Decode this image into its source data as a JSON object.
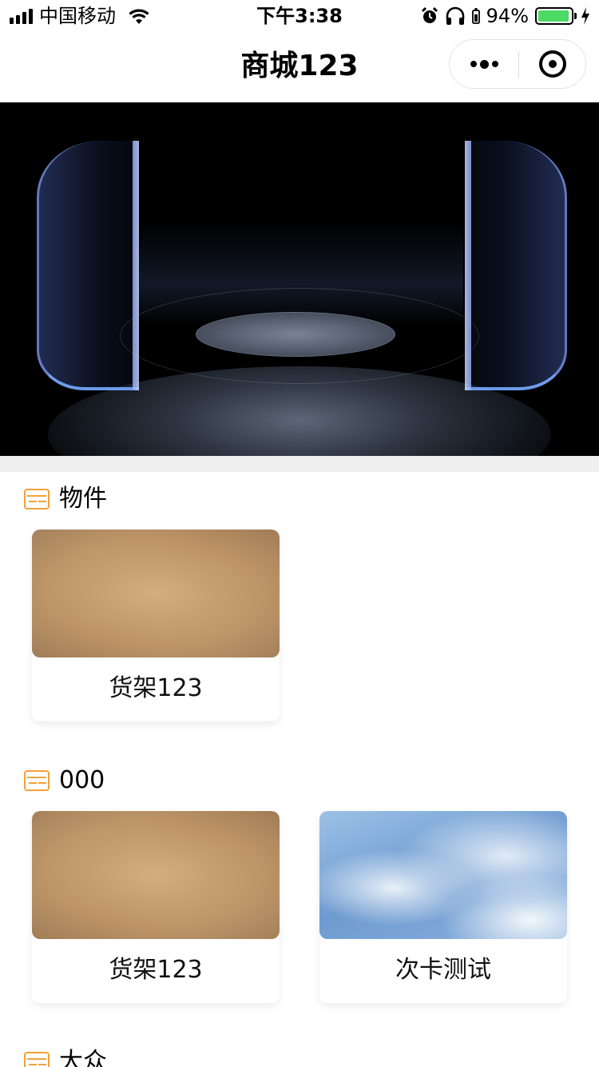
{
  "status_bar": {
    "carrier": "中国移动",
    "time": "下午3:38",
    "battery_percent": "94%",
    "battery_level": 0.94
  },
  "nav": {
    "title": "商城123"
  },
  "sections": [
    {
      "title": "物件",
      "products": [
        {
          "name": "货架123",
          "image": "kraft-paper"
        }
      ]
    },
    {
      "title": "000",
      "products": [
        {
          "name": "货架123",
          "image": "kraft-paper"
        },
        {
          "name": "次卡测试",
          "image": "blue-sky"
        }
      ]
    },
    {
      "title": "大众",
      "products": []
    }
  ],
  "colors": {
    "accent_icon": "#f3a23b",
    "battery_fill": "#4cd964",
    "separator": "#efefef"
  },
  "icons": [
    "signal-icon",
    "wifi-icon",
    "alarm-icon",
    "headphones-icon",
    "battery-icon",
    "charging-icon",
    "more-icon",
    "close-miniprogram-icon",
    "card-icon"
  ]
}
